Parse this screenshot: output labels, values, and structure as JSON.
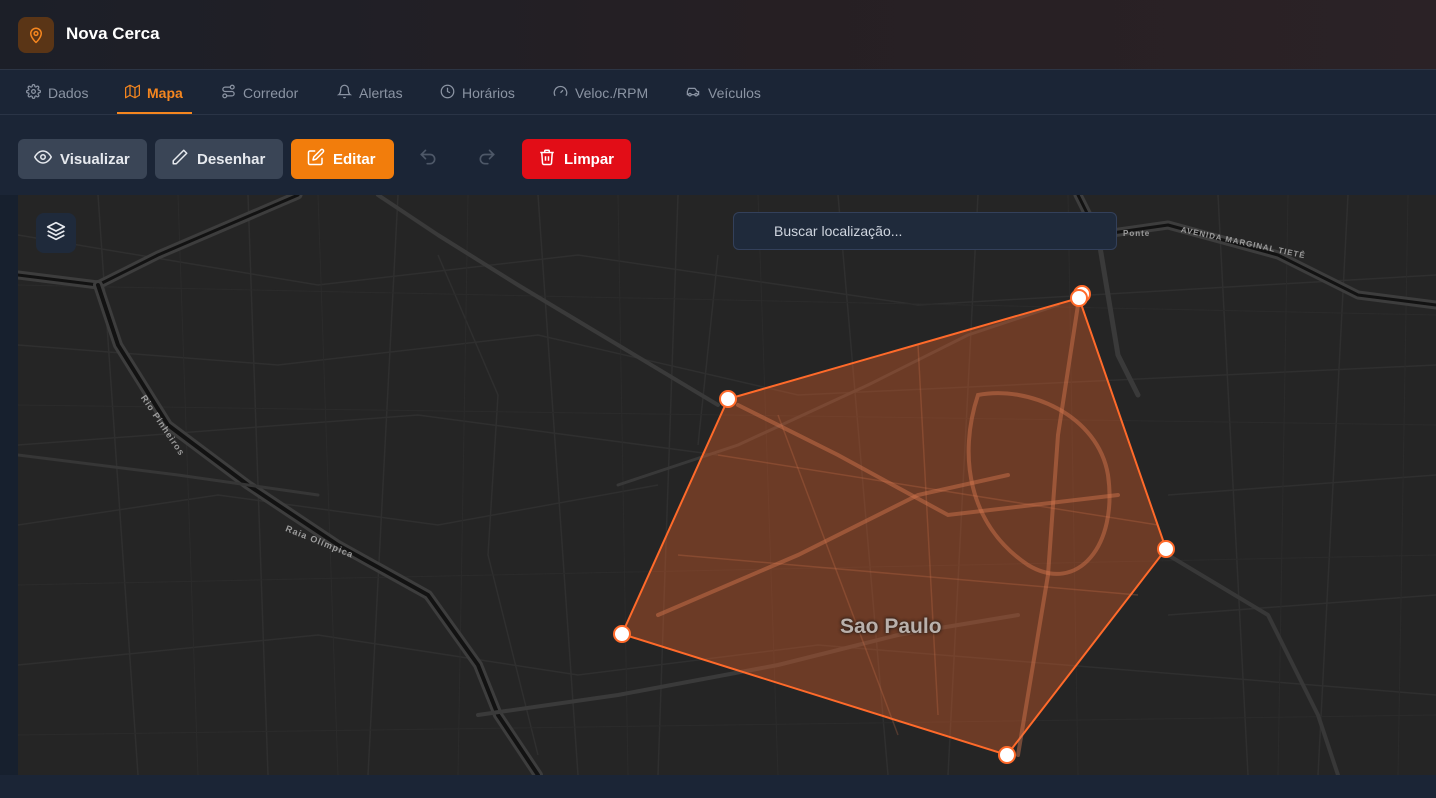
{
  "app": {
    "title": "Nova Cerca",
    "accent": "#f5861f"
  },
  "tabs": [
    {
      "label": "Dados",
      "icon": "gear-icon"
    },
    {
      "label": "Mapa",
      "icon": "map-icon",
      "active": true
    },
    {
      "label": "Corredor",
      "icon": "route-icon"
    },
    {
      "label": "Alertas",
      "icon": "bell-icon"
    },
    {
      "label": "Horários",
      "icon": "clock-icon"
    },
    {
      "label": "Veloc./RPM",
      "icon": "gauge-icon"
    },
    {
      "label": "Veículos",
      "icon": "car-icon"
    }
  ],
  "toolbar": {
    "view_label": "Visualizar",
    "draw_label": "Desenhar",
    "edit_label": "Editar",
    "clear_label": "Limpar",
    "undo_icon": "undo-icon",
    "redo_icon": "redo-icon"
  },
  "map": {
    "search_placeholder": "Buscar localização...",
    "city_label": "Sao Paulo",
    "road_labels": [
      "Rio Pinheiros",
      "Raia Olímpica",
      "AVENIDA MARGINAL TIETÊ",
      "Ponte"
    ],
    "geofence_color": "#ff6a2a",
    "geofence_vertex_count": 5
  }
}
